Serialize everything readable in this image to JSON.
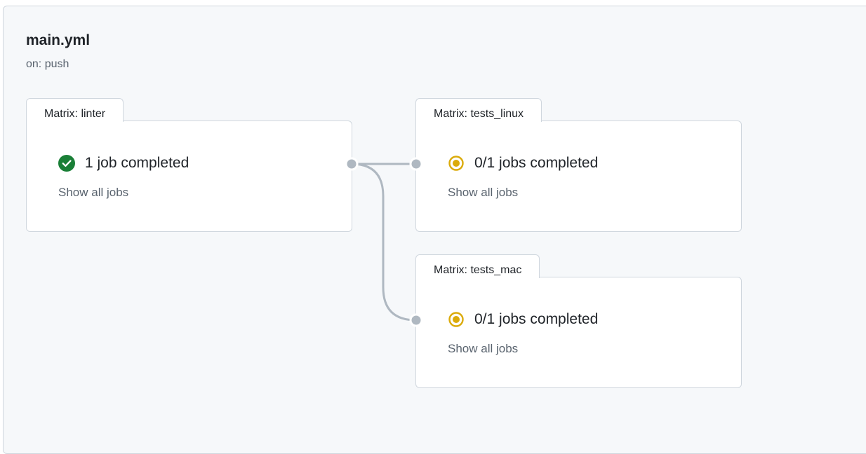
{
  "workflow": {
    "title": "main.yml",
    "trigger": "on: push"
  },
  "groups": [
    {
      "name": "Matrix: linter",
      "status": "success",
      "status_text": "1 job completed",
      "show_all": "Show all jobs",
      "icon": "check-circle-icon",
      "color": "#1a7f37"
    },
    {
      "name": "Matrix: tests_linux",
      "status": "in_progress",
      "status_text": "0/1 jobs completed",
      "show_all": "Show all jobs",
      "icon": "in-progress-icon",
      "color": "#dbab0a"
    },
    {
      "name": "Matrix: tests_mac",
      "status": "in_progress",
      "status_text": "0/1 jobs completed",
      "show_all": "Show all jobs",
      "icon": "in-progress-icon",
      "color": "#dbab0a"
    }
  ],
  "colors": {
    "connector": "#afb8c1",
    "canvas_bg": "#f6f8fa",
    "border": "#d0d7de"
  }
}
